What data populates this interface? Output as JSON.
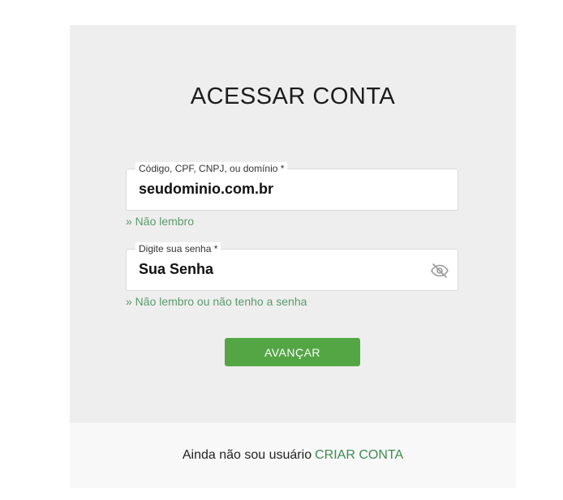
{
  "login": {
    "title": "ACESSAR CONTA",
    "user_field": {
      "label": "Código, CPF, CNPJ, ou domínio *",
      "value": "seudominio.com.br"
    },
    "user_help": "» Não lembro",
    "password_field": {
      "label": "Digite sua senha *",
      "value": "Sua Senha",
      "toggle_icon": "eye-off-icon"
    },
    "password_help": "» Não lembro ou não tenho a senha",
    "submit_label": "AVANÇAR"
  },
  "footer": {
    "text": "Ainda não sou usuário",
    "link": "CRIAR CONTA"
  },
  "colors": {
    "accent": "#54a645",
    "link": "#3d8b50",
    "card_bg": "#eeeeee"
  }
}
